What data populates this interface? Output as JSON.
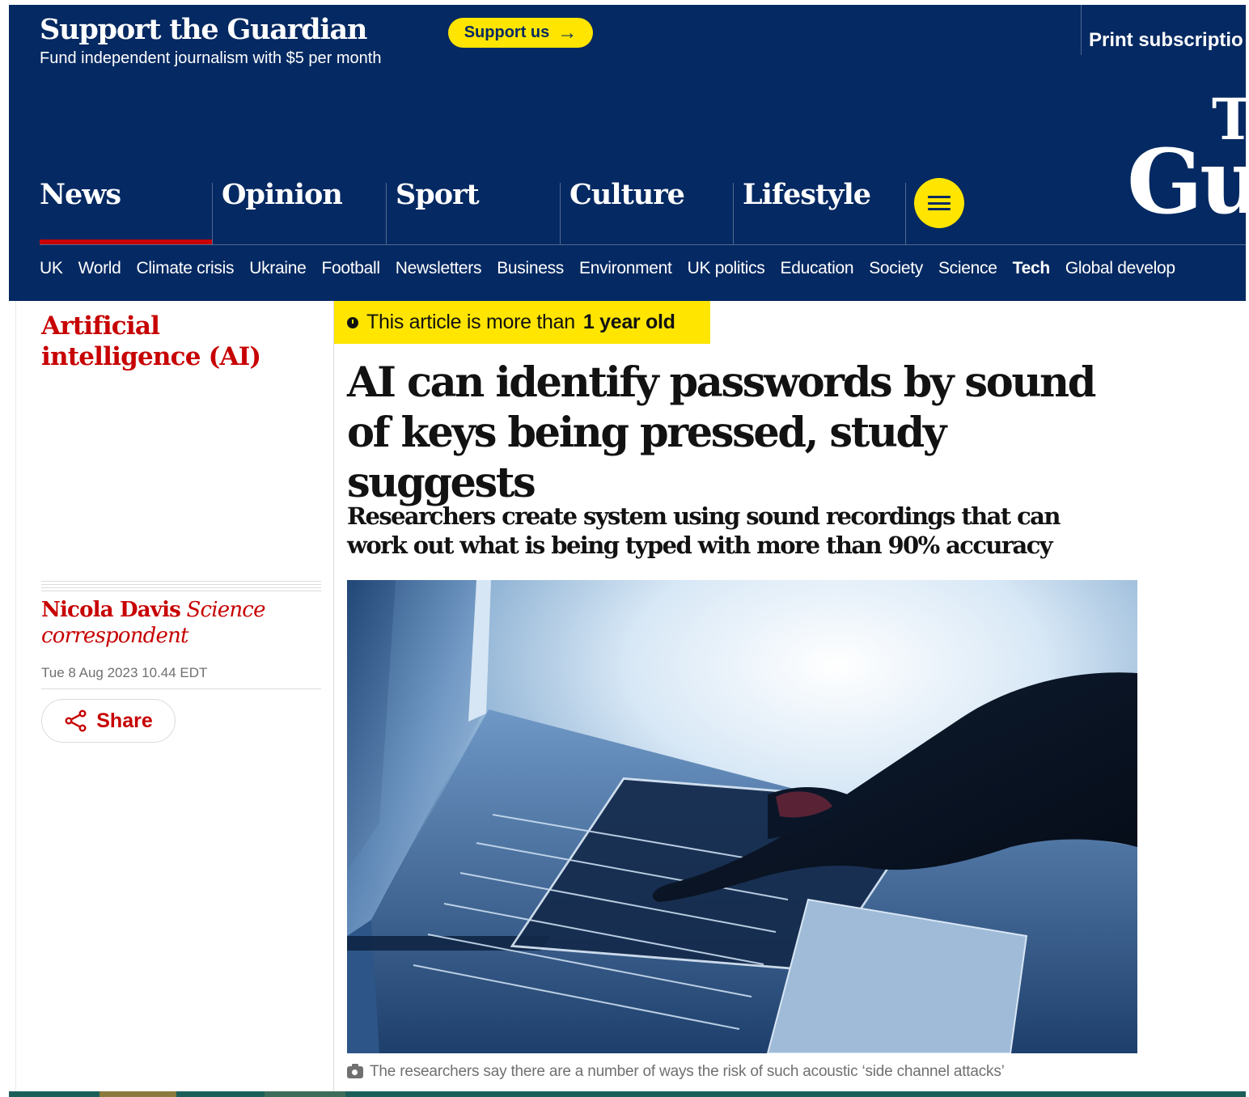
{
  "support": {
    "title": "Support the Guardian",
    "subtitle": "Fund independent journalism with $5 per month",
    "button_label": "Support us",
    "print_label": "Print subscriptio"
  },
  "masthead": {
    "logo_the": "T",
    "logo_guardian": "Gu",
    "pillars": [
      {
        "label": "News",
        "active": true
      },
      {
        "label": "Opinion"
      },
      {
        "label": "Sport"
      },
      {
        "label": "Culture"
      },
      {
        "label": "Lifestyle"
      }
    ],
    "subnav": [
      "UK",
      "World",
      "Climate crisis",
      "Ukraine",
      "Football",
      "Newsletters",
      "Business",
      "Environment",
      "UK politics",
      "Education",
      "Society",
      "Science",
      "Tech",
      "Global develop"
    ],
    "current_subnav": "Tech"
  },
  "article": {
    "section": "Artificial intelligence (AI)",
    "age_prefix": "This article is more than",
    "age_value": "1 year old",
    "headline": "AI can identify passwords by sound of keys being pressed, study suggests",
    "standfirst": "Researchers create system using sound recordings that can work out what is being typed with more than 90% accuracy",
    "author": "Nicola Davis",
    "author_role": "Science correspondent",
    "date": "Tue 8 Aug 2023 10.44 EDT",
    "share_label": "Share",
    "caption": "The researchers say there are a number of ways the risk of such acoustic ‘side channel attacks’"
  },
  "colors": {
    "brand_blue": "#052962",
    "accent_yellow": "#ffe500",
    "news_red": "#c70000"
  }
}
